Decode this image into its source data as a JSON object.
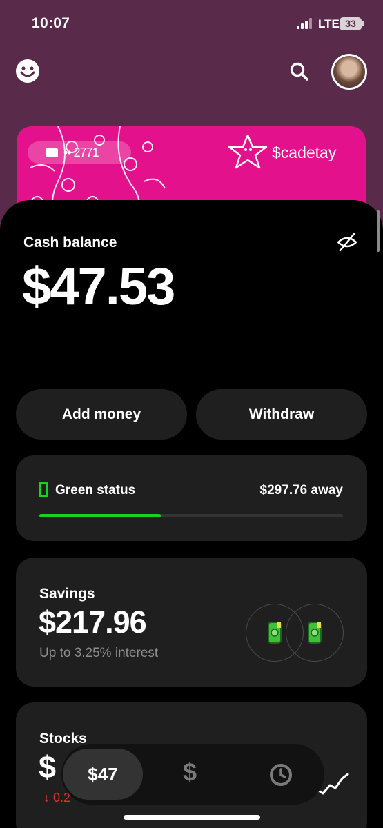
{
  "status_bar": {
    "time": "10:07",
    "network": "LTE",
    "battery": "33"
  },
  "header": {
    "avatar_icon": "avatar",
    "search_icon": "search-icon",
    "profile_icon": "smiley-icon"
  },
  "card": {
    "last_digits": "•• 2771",
    "cashtag": "$cadetay",
    "color": "#e4118c"
  },
  "balance": {
    "label": "Cash balance",
    "amount": "$47.53"
  },
  "actions": {
    "add_money": "Add money",
    "withdraw": "Withdraw"
  },
  "green_status": {
    "label": "Green status",
    "away": "$297.76 away",
    "progress": 0.4,
    "color": "#17d31b"
  },
  "savings": {
    "label": "Savings",
    "amount": "$217.96",
    "subtitle": "Up to 3.25% interest"
  },
  "stocks": {
    "label": "Stocks",
    "amount": "$",
    "change": "↓ 0.2"
  },
  "nav": {
    "balance": "$47",
    "money_tab": "$",
    "activity_icon": "clock-icon"
  }
}
